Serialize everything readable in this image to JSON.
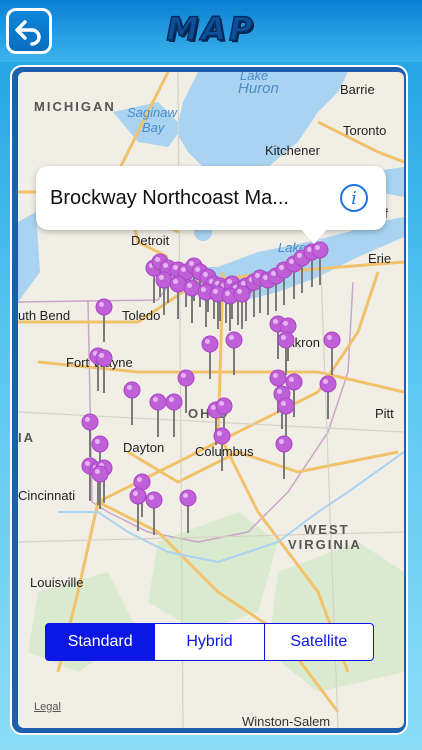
{
  "header": {
    "title": "MAP",
    "back_icon": "back-arrow-icon"
  },
  "map": {
    "states": [
      "MICHIGAN",
      "OHIO",
      "WEST",
      "VIRGINIA",
      "IA"
    ],
    "water": [
      "Lake",
      "Huron",
      "Saginaw",
      "Bay",
      "Lake"
    ],
    "cities": [
      "Barrie",
      "Toronto",
      "Kitchener",
      "Detroit",
      "Erie",
      "uth Bend",
      "Toledo",
      "Fort Wayne",
      "Akron",
      "Pitt",
      "Dayton",
      "Columbus",
      "Cincinnati",
      "Louisville",
      "uf"
    ],
    "legal": "Legal",
    "bottom_city": "Winston-Salem"
  },
  "callout": {
    "title": "Brockway Northcoast Ma...",
    "info_icon": "info-icon"
  },
  "map_type": {
    "options": [
      "Standard",
      "Hybrid",
      "Satellite"
    ],
    "selected": "Standard"
  },
  "colors": {
    "accent": "#0c17e6",
    "pin": "#c060d8",
    "water": "#a9d3f0",
    "header": "#1a9fe0"
  }
}
